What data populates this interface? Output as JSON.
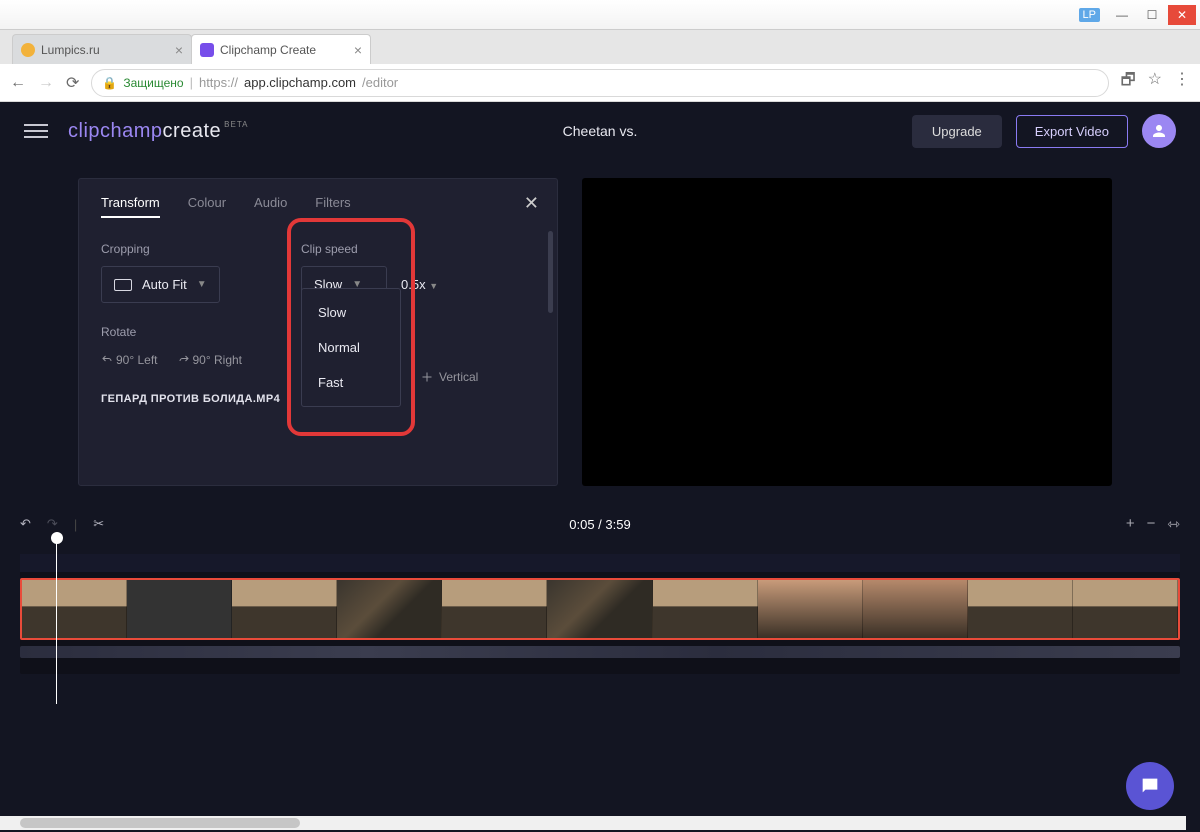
{
  "window": {
    "user_tag": "LP"
  },
  "browser": {
    "tabs": [
      {
        "label": "Lumpics.ru",
        "fav_color": "#f2b23b"
      },
      {
        "label": "Clipchamp Create",
        "fav_color": "#774eea"
      }
    ],
    "secure_label": "Защищено",
    "url_host": "https://",
    "url_domain": "app.clipchamp.com",
    "url_path": "/editor"
  },
  "header": {
    "logo_part1": "clipchamp",
    "logo_part2": "create",
    "logo_badge": "BETA",
    "project_title": "Cheetan vs.",
    "upgrade": "Upgrade",
    "export": "Export Video"
  },
  "panel": {
    "tabs": {
      "transform": "Transform",
      "colour": "Colour",
      "audio": "Audio",
      "filters": "Filters"
    },
    "cropping_label": "Cropping",
    "cropping_value": "Auto Fit",
    "speed_label": "Clip speed",
    "speed_value": "Slow",
    "speed_mult": "0.5x",
    "speed_options": {
      "slow": "Slow",
      "normal": "Normal",
      "fast": "Fast"
    },
    "rotate_label": "Rotate",
    "rotate_left": "90° Left",
    "rotate_right": "90° Right",
    "flip_vertical": "Vertical",
    "filename": "ГЕПАРД ПРОТИВ БОЛИДА.MP4"
  },
  "timeline": {
    "time_display": "0:05 / 3:59"
  }
}
